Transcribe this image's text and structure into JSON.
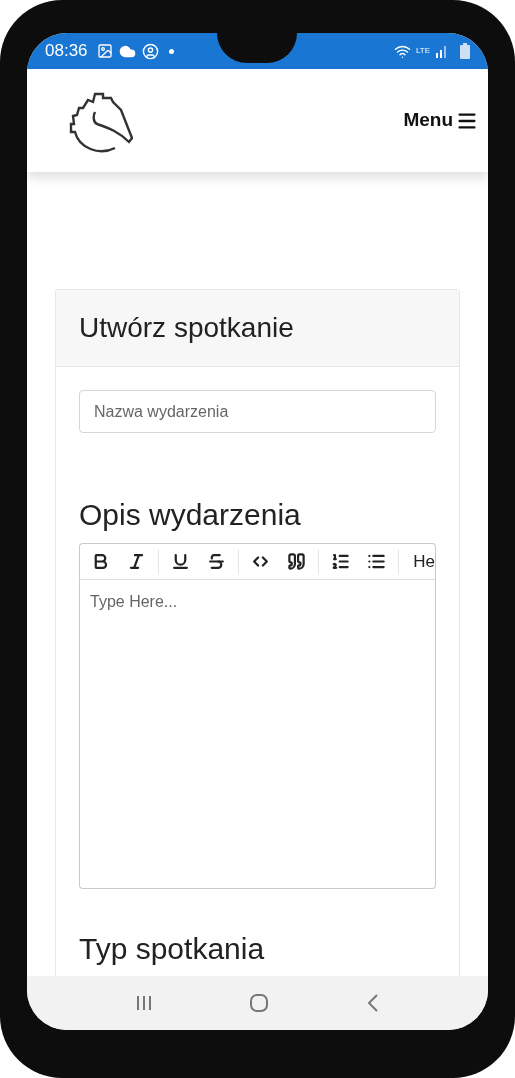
{
  "status_bar": {
    "time": "08:36",
    "network": "LTE"
  },
  "header": {
    "menu_label": "Menu"
  },
  "card": {
    "title": "Utwórz spotkanie",
    "name_field": {
      "placeholder": "Nazwa wydarzenia"
    },
    "description_heading": "Opis wydarzenia",
    "editor": {
      "toolbar": [
        {
          "kind": "bold"
        },
        {
          "kind": "italic"
        },
        {
          "kind": "separator"
        },
        {
          "kind": "underline"
        },
        {
          "kind": "strikethrough"
        },
        {
          "kind": "separator"
        },
        {
          "kind": "code"
        },
        {
          "kind": "quote"
        },
        {
          "kind": "separator"
        },
        {
          "kind": "ordered-list"
        },
        {
          "kind": "bullet-list"
        },
        {
          "kind": "separator"
        },
        {
          "kind": "heading",
          "label": "He"
        }
      ],
      "placeholder": "Type Here..."
    },
    "type_heading": "Typ spotkania"
  }
}
